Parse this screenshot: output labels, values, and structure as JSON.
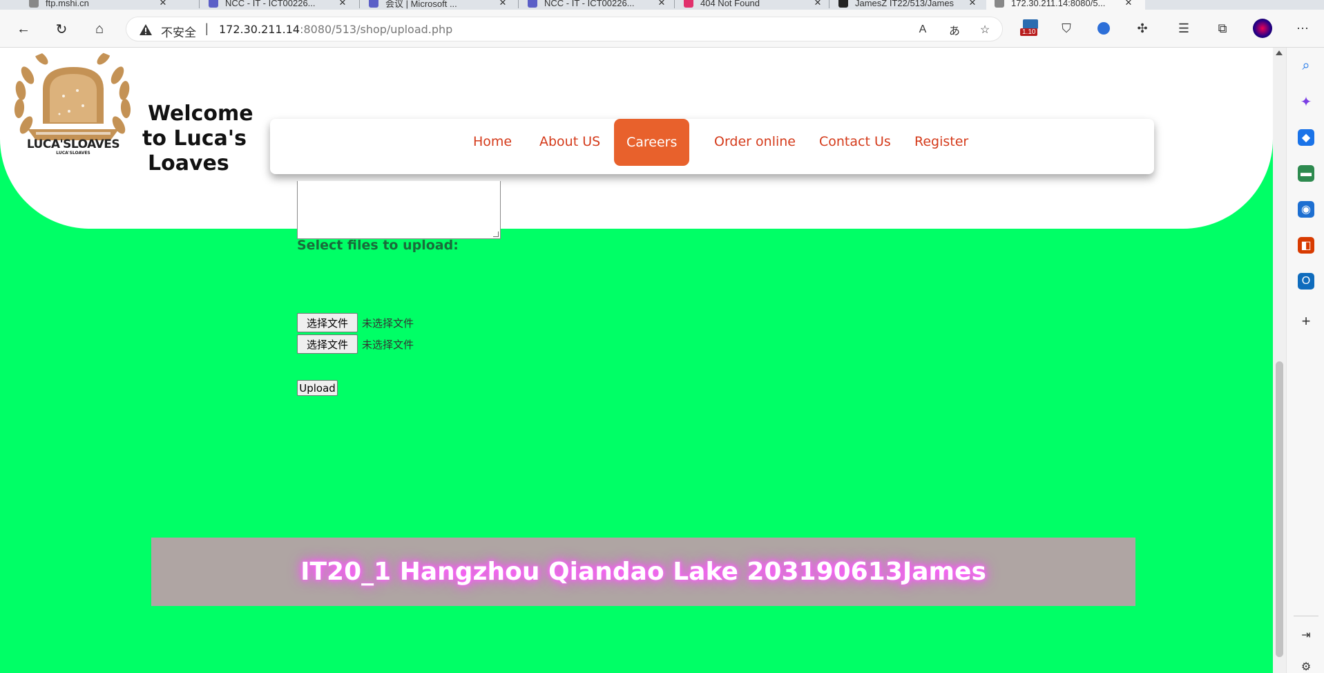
{
  "browser": {
    "tabs": [
      {
        "title": "ftp.mshi.cn",
        "favicon_color": "#888888"
      },
      {
        "title": "NCC - IT - ICT00226...",
        "favicon_color": "#5b5fc7"
      },
      {
        "title": "会议 | Microsoft ...",
        "favicon_color": "#5b5fc7"
      },
      {
        "title": "NCC - IT - ICT00226...",
        "favicon_color": "#5b5fc7"
      },
      {
        "title": "404 Not Found",
        "favicon_color": "#e1306c"
      },
      {
        "title": "JamesZ IT22/513/James",
        "favicon_color": "#222222"
      },
      {
        "title": "172.30.211.14:8080/5...",
        "favicon_color": "#888888"
      }
    ],
    "address": {
      "insecure_label": "不安全",
      "separator": "|",
      "url_host": "172.30.211.14",
      "url_rest": ":8080/513/shop/upload.php"
    },
    "extension_badge": "1.10"
  },
  "site": {
    "logo_text": "LUCA'SLOAVES",
    "logo_subtext": "LUCA'SLOAVES",
    "welcome_line1": "Welcome",
    "welcome_line2": "to Luca's",
    "welcome_line3": "Loaves",
    "nav": [
      {
        "label": "Home",
        "active": false
      },
      {
        "label": "About US",
        "active": false
      },
      {
        "label": "Careers",
        "active": true
      },
      {
        "label": "Order online",
        "active": false
      },
      {
        "label": "Contact Us",
        "active": false
      },
      {
        "label": "Register",
        "active": false
      }
    ],
    "accent_color": "#e8612c",
    "page_background": "#00ff66"
  },
  "form": {
    "select_label": "Select files to upload:",
    "file_inputs": [
      {
        "button": "选择文件",
        "status": "未选择文件"
      },
      {
        "button": "选择文件",
        "status": "未选择文件"
      }
    ],
    "upload_button": "Upload"
  },
  "footer": {
    "text": "IT20_1 Hangzhou Qiandao Lake 203190613James"
  }
}
